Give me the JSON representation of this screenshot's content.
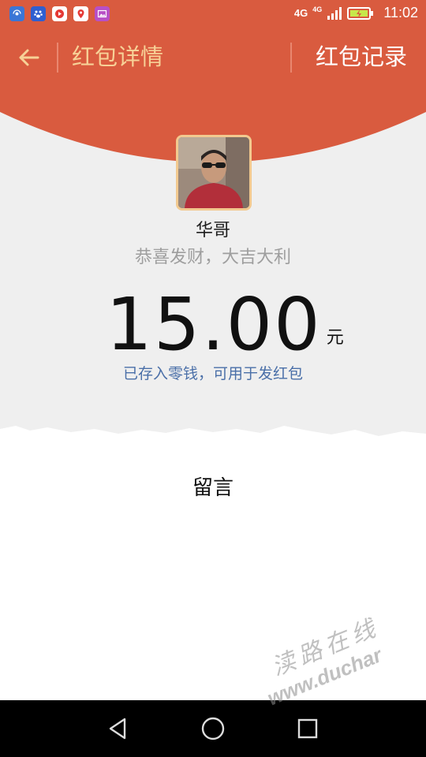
{
  "status_bar": {
    "network_primary": "4G",
    "network_secondary": "4G",
    "time": "11:02",
    "notification_icons": [
      "wifi-signal-icon",
      "baidu-paw-icon",
      "video-play-icon",
      "map-pin-icon",
      "photo-gallery-icon"
    ]
  },
  "header": {
    "title": "红包详情",
    "records_link": "红包记录",
    "background_color": "#d95b3f",
    "title_color": "#f7d197"
  },
  "detail": {
    "sender_name": "华哥",
    "greeting": "恭喜发财，大吉大利",
    "amount": "15.00",
    "unit": "元",
    "deposit_note": "已存入零钱，可用于发红包"
  },
  "message_section": {
    "label": "留言"
  },
  "watermark": {
    "chinese": "渎路在线",
    "url": "www.duchar"
  },
  "colors": {
    "accent_red": "#d95b3f",
    "gold": "#f7d197",
    "link_blue": "#4a6fa8"
  }
}
